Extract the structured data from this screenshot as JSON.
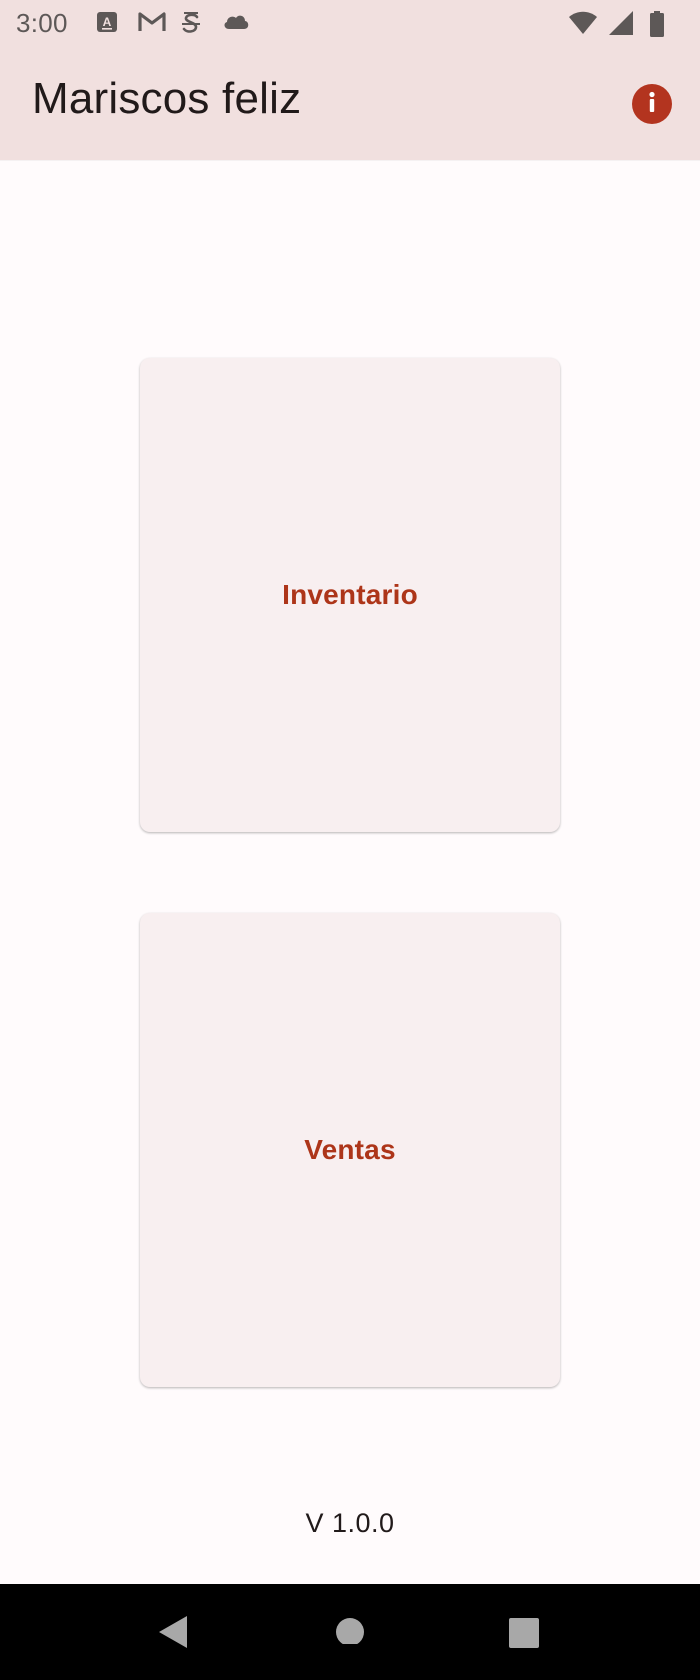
{
  "status_bar": {
    "time": "3:00",
    "left_icons": [
      "a-box-icon",
      "gmail-icon",
      "s-shield-icon",
      "cloud-icon"
    ],
    "right_icons": [
      "wifi-icon",
      "signal-icon",
      "battery-icon"
    ]
  },
  "app_bar": {
    "title": "Mariscos feliz",
    "info_icon": "info-icon"
  },
  "cards": {
    "inventario": {
      "label": "Inventario"
    },
    "ventas": {
      "label": "Ventas"
    }
  },
  "footer": {
    "version": "V 1.0.0"
  },
  "nav_bar": {
    "icons": [
      "back-icon",
      "home-icon",
      "recents-icon"
    ]
  },
  "colors": {
    "app_bar_bg": "#f1e0df",
    "background": "#fffbfc",
    "accent": "#b3341f",
    "card_bg": "#f8eff0",
    "card_text": "#ad3519",
    "nav_bar_bg": "#000000"
  }
}
